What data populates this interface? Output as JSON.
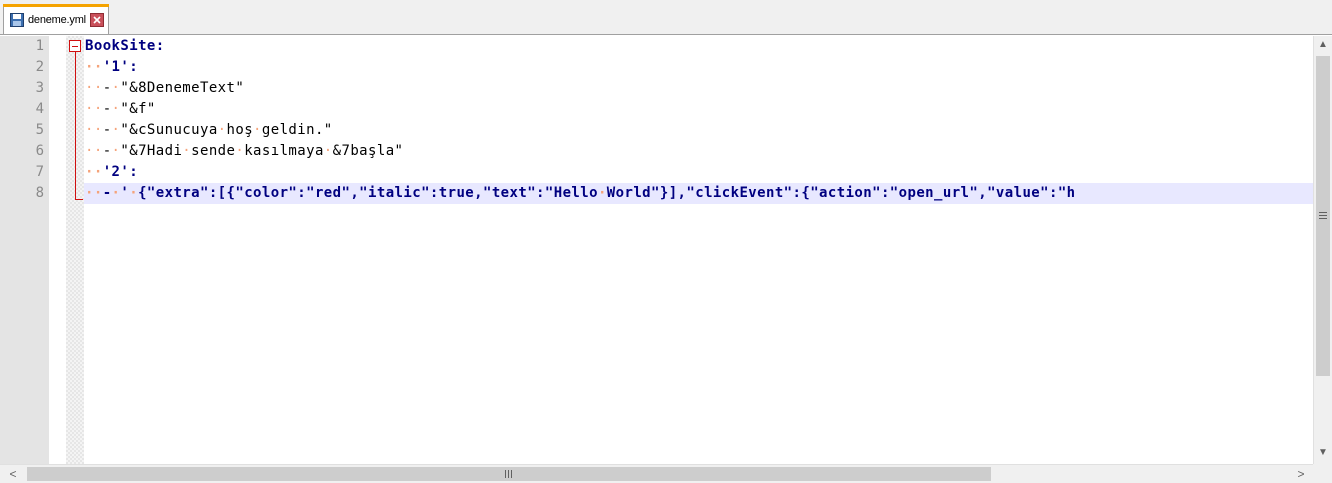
{
  "tab": {
    "filename": "deneme.yml",
    "icon": "floppy-disk-icon",
    "close_icon": "close-icon"
  },
  "colors": {
    "keyword": "#000080",
    "whitespace_marker": "#f5a37a",
    "fold_marker": "#d01010",
    "current_line": "#e8e8ff",
    "tab_accent": "#f5a300"
  },
  "editor": {
    "line_numbers": [
      "1",
      "2",
      "3",
      "4",
      "5",
      "6",
      "7",
      "8"
    ],
    "lines": [
      "BookSite:",
      "··'1':",
      "··-·\"&8DenemeText\"",
      "··-·\"&f\"",
      "··-·\"&cSunucuya·hoş·geldin.\"",
      "··-·\"&7Hadi·sende·kasılmaya·&7başla\"",
      "··'2':",
      "··-·'·{\"extra\":[{\"color\":\"red\",\"italic\":true,\"text\":\"Hello·World\"}],\"clickEvent\":{\"action\":\"open_url\",\"value\":\"h"
    ]
  },
  "scrollbars": {
    "vertical_up": "up-arrow-icon",
    "vertical_down": "down-arrow-icon",
    "horizontal_left": "left-arrow-icon",
    "horizontal_right": "right-arrow-icon"
  }
}
